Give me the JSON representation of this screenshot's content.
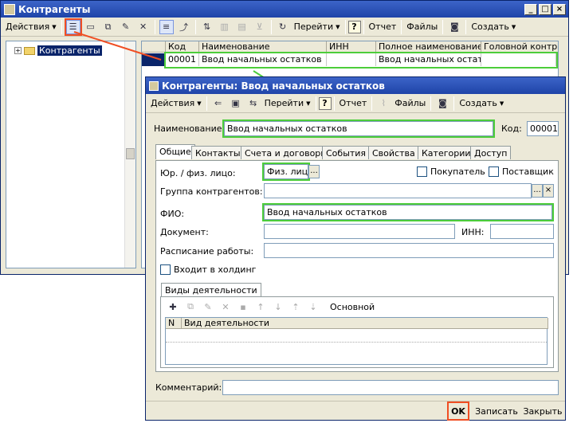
{
  "main": {
    "title": "Контрагенты",
    "toolbar": {
      "actions": "Действия",
      "goto": "Перейти",
      "report": "Отчет",
      "files": "Файлы",
      "create": "Создать",
      "help": "?"
    },
    "tree_root": "Контрагенты",
    "grid": {
      "headers": [
        "Код",
        "Наименование",
        "ИНН",
        "Полное наименование",
        "Головной контраг"
      ],
      "row": [
        "00001",
        "Ввод начальных остатков",
        "",
        "Ввод начальных остатк…",
        ""
      ]
    }
  },
  "dialog": {
    "title": "Контрагенты: Ввод начальных остатков",
    "toolbar": {
      "actions": "Действия",
      "goto": "Перейти",
      "report": "Отчет",
      "files": "Файлы",
      "create": "Создать",
      "help": "?"
    },
    "name_label": "Наименование:",
    "name_value": "Ввод начальных остатков",
    "code_label": "Код:",
    "code_value": "00001",
    "tabs": [
      "Общие",
      "Контакты",
      "Счета и договоры",
      "События",
      "Свойства",
      "Категории",
      "Доступ"
    ],
    "legal_label": "Юр. / физ. лицо:",
    "legal_value": "Физ. лицо",
    "buyer_label": "Покупатель",
    "supplier_label": "Поставщик",
    "group_label": "Группа контрагентов:",
    "fio_label": "ФИО:",
    "fio_value": "Ввод начальных остатков",
    "doc_label": "Документ:",
    "inn_label": "ИНН:",
    "schedule_label": "Расписание работы:",
    "holding_label": "Входит в холдинг",
    "activity_tab": "Виды деятельности",
    "activity_primary": "Основной",
    "activity_headers": [
      "N",
      "Вид деятельности"
    ],
    "comment_label": "Комментарий:",
    "ok_label": "OK",
    "save_label": "Записать",
    "close_label": "Закрыть"
  },
  "colors": {
    "title_bar": "#1f44a8",
    "highlight_orange": "#f04e23",
    "highlight_green": "#4ccd3a",
    "selection": "#0a246a"
  }
}
